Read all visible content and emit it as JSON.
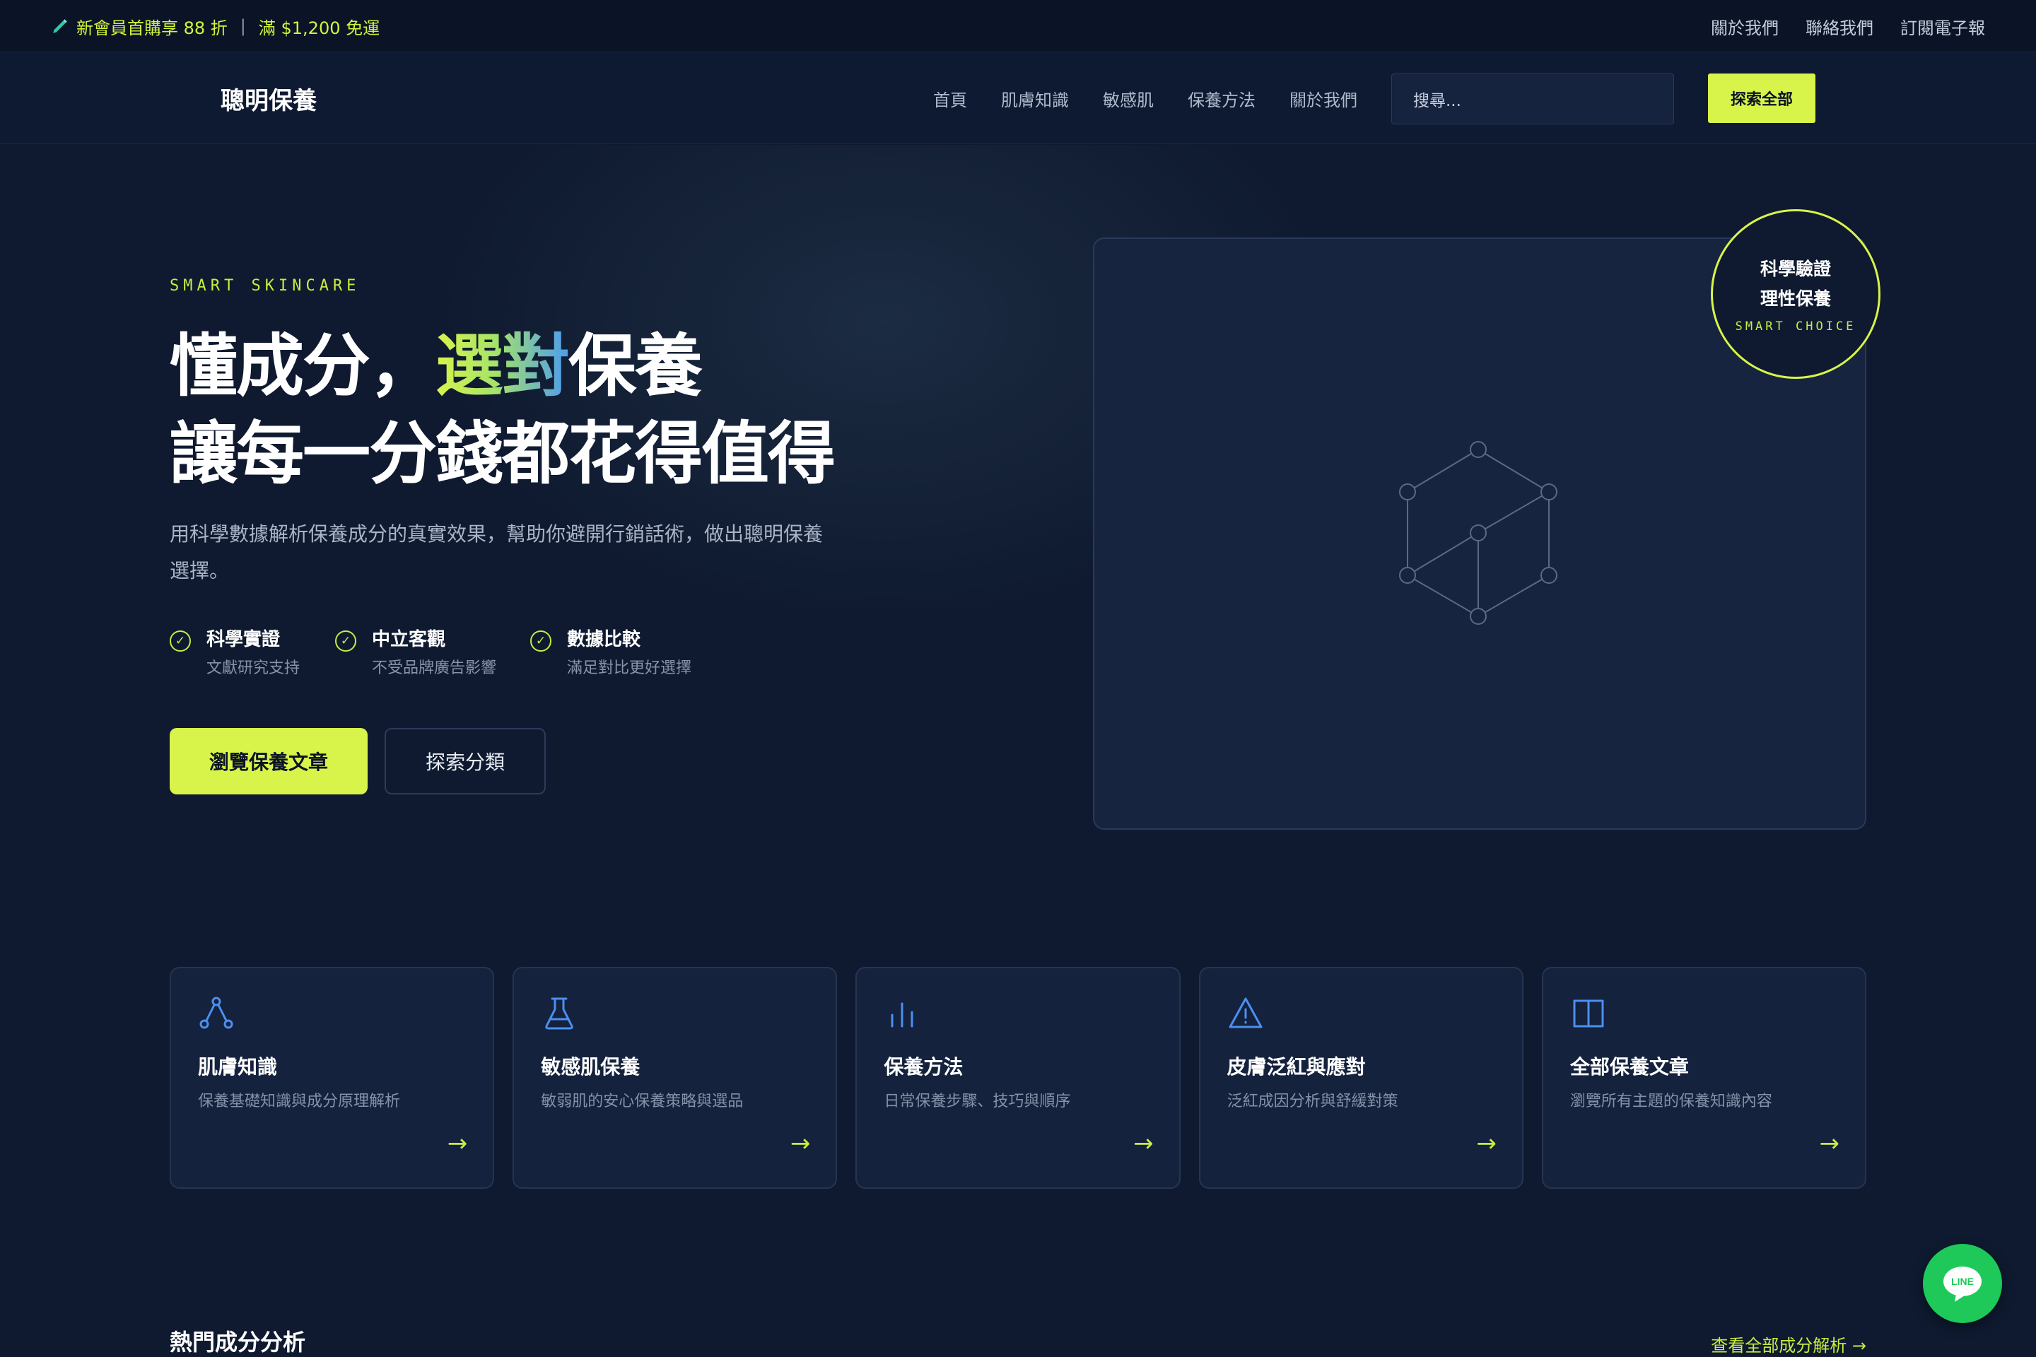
{
  "promo": {
    "left_text": "新會員首購享 88 折",
    "separator": "|",
    "right_text": "滿 $1,200 免運",
    "links": [
      "關於我們",
      "聯絡我們",
      "訂閱電子報"
    ]
  },
  "nav": {
    "logo": "聰明保養",
    "links": [
      "首頁",
      "肌膚知識",
      "敏感肌",
      "保養方法",
      "關於我們"
    ],
    "search_placeholder": "搜尋...",
    "search_button": "探索全部"
  },
  "hero": {
    "eyebrow": "SMART SKINCARE",
    "title_line1_a": "懂成分，",
    "title_line1_b": "選對",
    "title_line1_c": "保養",
    "title_line2": "讓每一分錢都花得值得",
    "description": "用科學數據解析保養成分的真實效果，幫助你避開行銷話術，做出聰明保養選擇。",
    "features": [
      {
        "title": "科學實證",
        "subtitle": "文獻研究支持"
      },
      {
        "title": "中立客觀",
        "subtitle": "不受品牌廣告影響"
      },
      {
        "title": "數據比較",
        "subtitle": "滿足對比更好選擇"
      }
    ],
    "primary_button": "瀏覽保養文章",
    "secondary_button": "探索分類",
    "badge": {
      "line1": "科學驗證",
      "line2": "理性保養",
      "line3": "SMART CHOICE"
    }
  },
  "categories": [
    {
      "icon": "molecule-icon",
      "title": "肌膚知識",
      "subtitle": "保養基礎知識與成分原理解析"
    },
    {
      "icon": "flask-icon",
      "title": "敏感肌保養",
      "subtitle": "敏弱肌的安心保養策略與選品"
    },
    {
      "icon": "bar-chart-icon",
      "title": "保養方法",
      "subtitle": "日常保養步驟、技巧與順序"
    },
    {
      "icon": "warning-icon",
      "title": "皮膚泛紅與應對",
      "subtitle": "泛紅成因分析與舒緩對策"
    },
    {
      "icon": "book-icon",
      "title": "全部保養文章",
      "subtitle": "瀏覽所有主題的保養知識內容"
    }
  ],
  "ingredients_section": {
    "title": "熱門成分分析",
    "link": "查看全部成分解析 →"
  },
  "line_button": {
    "label": "LINE"
  },
  "colors": {
    "accent": "#d8f34a",
    "background": "#0f1a30",
    "card": "#14223d",
    "line_green": "#1ec95a"
  }
}
